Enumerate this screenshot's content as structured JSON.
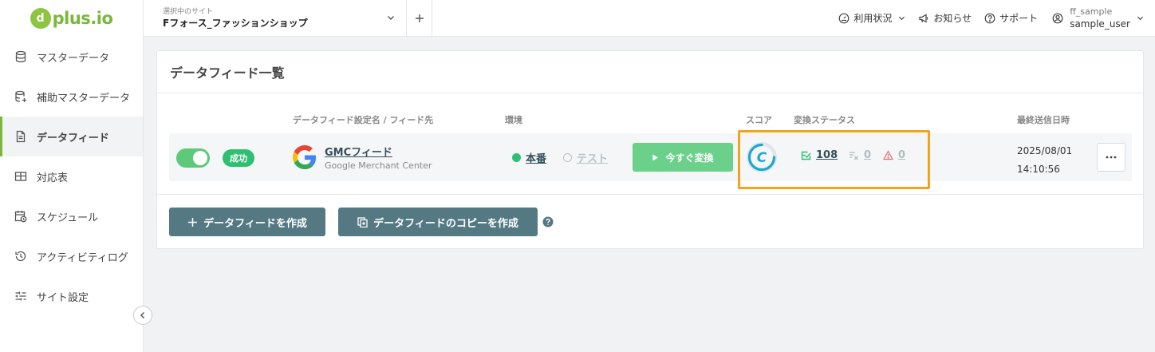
{
  "logo": {
    "mark": "d",
    "text": "plus.io"
  },
  "sidebar": {
    "items": [
      {
        "label": "マスターデータ",
        "icon": "database-icon"
      },
      {
        "label": "補助マスターデータ",
        "icon": "database-plus-icon"
      },
      {
        "label": "データフィード",
        "icon": "document-icon",
        "active": true
      },
      {
        "label": "対応表",
        "icon": "table-icon"
      },
      {
        "label": "スケジュール",
        "icon": "calendar-clock-icon"
      },
      {
        "label": "アクティビティログ",
        "icon": "history-icon"
      },
      {
        "label": "サイト設定",
        "icon": "sliders-icon"
      }
    ]
  },
  "header": {
    "site_caption": "選択中のサイト",
    "site_name": "Fフォース_ファッションショップ",
    "usage": "利用状況",
    "news": "お知らせ",
    "support": "サポート",
    "user_org": "ff_sample",
    "user_name": "sample_user"
  },
  "card": {
    "title": "データフィード一覧",
    "columns": {
      "name": "データフィード設定名 / フィード先",
      "env": "環境",
      "score": "スコア",
      "status": "変換ステータス",
      "last_sent": "最終送信日時"
    },
    "rows": [
      {
        "badge": "成功",
        "enabled": true,
        "feed_name": "GMCフィード",
        "destination": "Google Merchant Center",
        "env_prod": "本番",
        "env_test": "テスト",
        "convert_label": "今すぐ変換",
        "score_letter": "C",
        "score_fraction": 0.75,
        "stat_ok": "108",
        "stat_excluded": "0",
        "stat_warning": "0",
        "sent_date": "2025/08/01",
        "sent_time": "14:10:56"
      }
    ],
    "create_label": "データフィードを作成",
    "copy_label": "データフィードのコピーを作成"
  },
  "colors": {
    "accent_green": "#7ab83a",
    "success": "#2fbf71",
    "button_dark": "#547983",
    "highlight": "#f5a31a",
    "score": "#1aa7d6"
  }
}
